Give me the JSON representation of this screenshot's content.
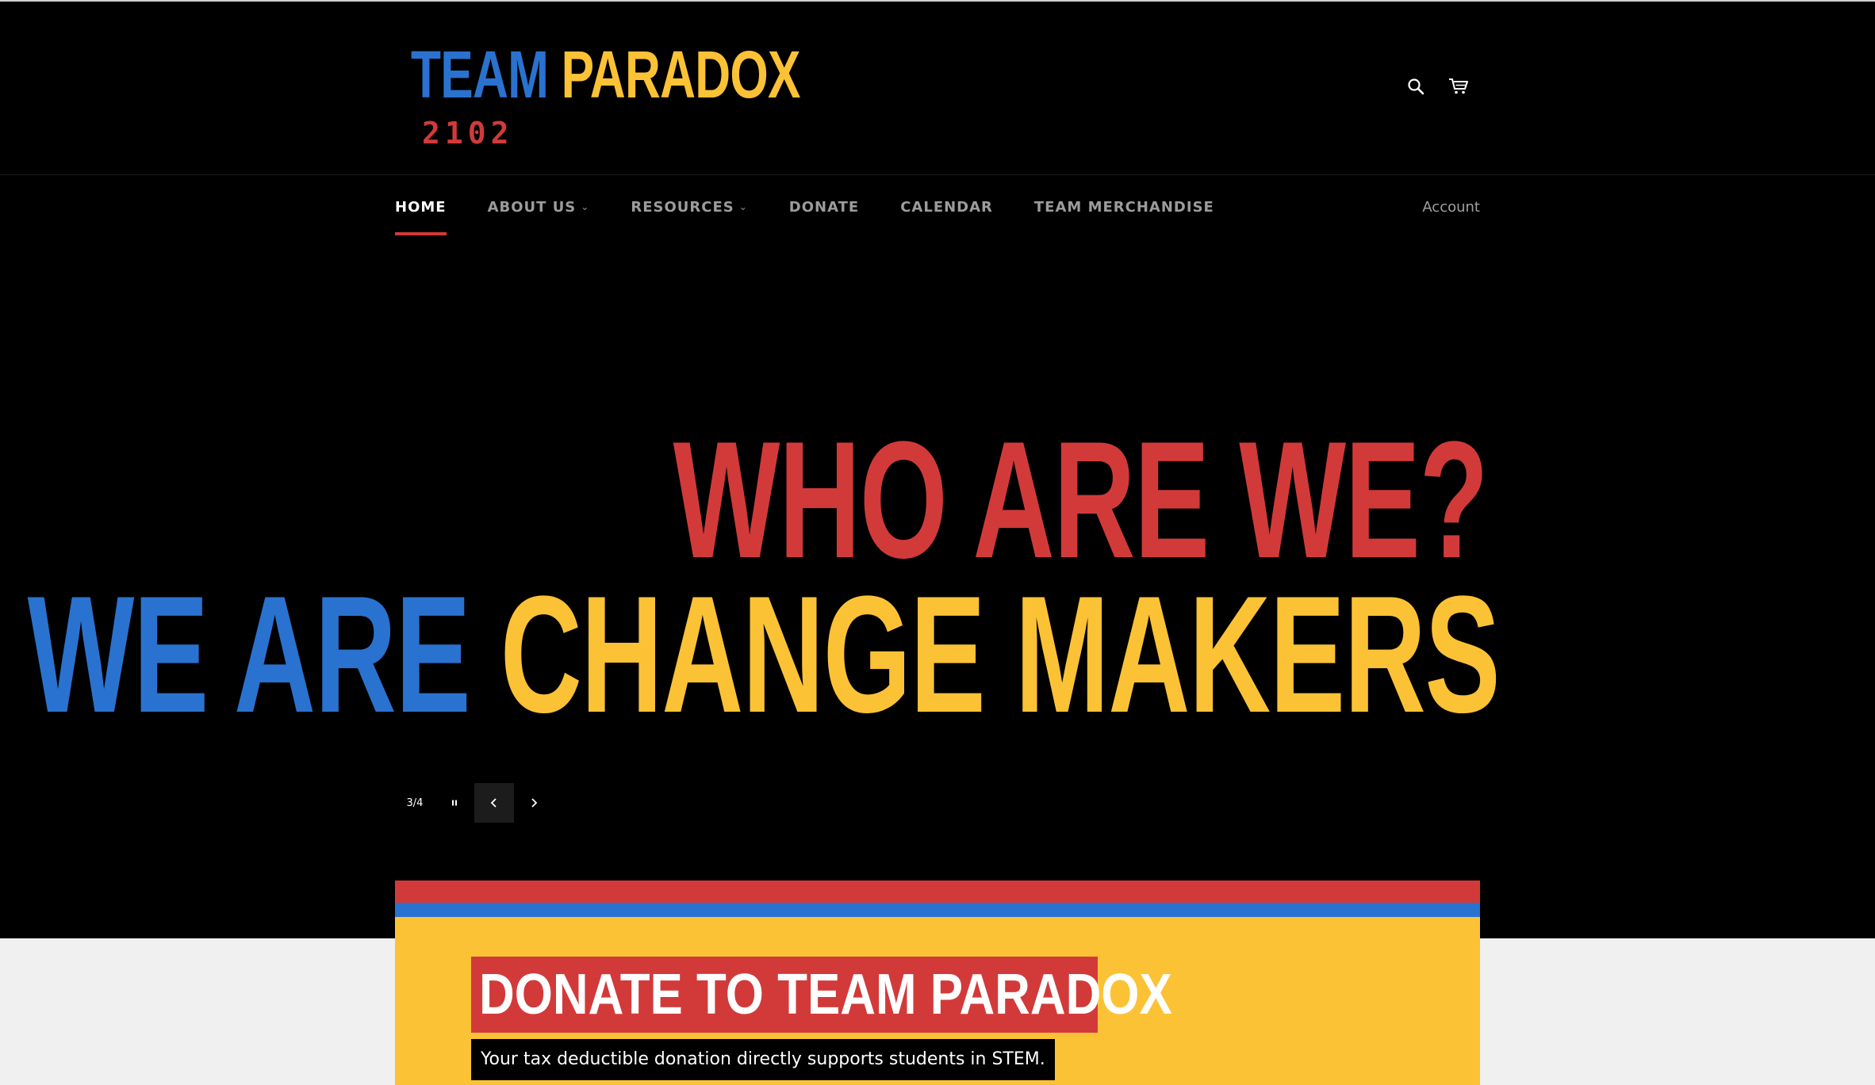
{
  "header": {
    "logo": {
      "word1": "TEAM",
      "word2": "PARADOX",
      "number": "2102"
    },
    "icons": [
      "search-icon",
      "cart-icon"
    ]
  },
  "nav": {
    "items": [
      {
        "label": "HOME",
        "active": true,
        "has_dropdown": false
      },
      {
        "label": "ABOUT US",
        "active": false,
        "has_dropdown": true
      },
      {
        "label": "RESOURCES",
        "active": false,
        "has_dropdown": true
      },
      {
        "label": "DONATE",
        "active": false,
        "has_dropdown": false
      },
      {
        "label": "CALENDAR",
        "active": false,
        "has_dropdown": false
      },
      {
        "label": "TEAM MERCHANDISE",
        "active": false,
        "has_dropdown": false
      }
    ],
    "account": "Account"
  },
  "hero": {
    "line1": "WHO ARE WE?",
    "line2_part1": "WE ARE",
    "line2_part2": "CHANGE MAKERS",
    "slide_counter": "3/4"
  },
  "donate": {
    "title": "DONATE TO TEAM PARADOX",
    "subtitle": "Your tax deductible donation directly supports students in STEM."
  },
  "colors": {
    "red": "#d23a3a",
    "blue": "#2a72cf",
    "yellow": "#fcc236",
    "background": "#000000",
    "lower_background": "#f0f0f0"
  }
}
